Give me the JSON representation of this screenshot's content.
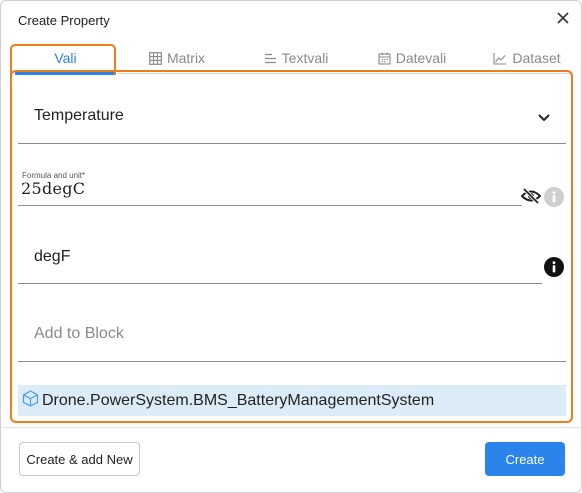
{
  "dialog": {
    "title": "Create Property",
    "close_icon": "close-icon"
  },
  "tabs": [
    {
      "label": "Vali",
      "icon": "",
      "active": true
    },
    {
      "label": "Matrix",
      "icon": "table-icon",
      "active": false
    },
    {
      "label": "Textvali",
      "icon": "text-lines-icon",
      "active": false
    },
    {
      "label": "Datevali",
      "icon": "calendar-icon",
      "active": false
    },
    {
      "label": "Dataset",
      "icon": "chart-icon",
      "active": false
    }
  ],
  "form": {
    "quantity_select": {
      "value": "Temperature",
      "icon": "chevron-down-icon"
    },
    "formula": {
      "label": "Formula and unit*",
      "value": "25degC",
      "visibility_icon": "eye-off-icon",
      "info_icon": "info-icon"
    },
    "display_unit": {
      "value": "degF",
      "info_icon": "info-icon"
    },
    "add_to_block": {
      "placeholder": "Add to Block"
    },
    "block_path": {
      "value": "Drone.PowerSystem.BMS_BatteryManagementSystem",
      "icon": "cube-icon"
    }
  },
  "footer": {
    "secondary_label": "Create & add New",
    "primary_label": "Create"
  },
  "colors": {
    "accent": "#2b84e9",
    "highlight": "#ef7b1a",
    "chip_bg": "#dcebf8"
  }
}
